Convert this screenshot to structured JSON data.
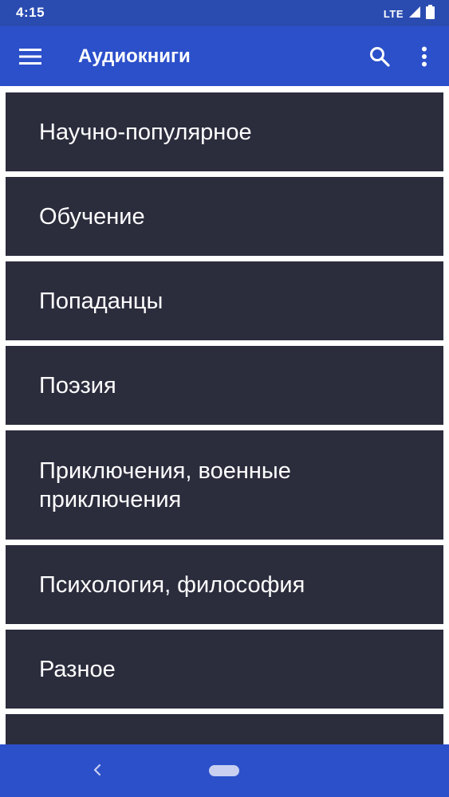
{
  "status_bar": {
    "time": "4:15",
    "network": "LTE"
  },
  "app_bar": {
    "title": "Аудиокниги",
    "icons": [
      "menu-icon",
      "search-icon",
      "more-vert-icon"
    ]
  },
  "categories": [
    "Научно-популярное",
    "Обучение",
    "Попаданцы",
    "Поэзия",
    "Приключения, военные приключения",
    "Психология, философия",
    "Разное",
    ""
  ],
  "nav_bar": {
    "icons": [
      "back-icon",
      "home-pill-icon"
    ]
  },
  "colors": {
    "status_bar": "#2a4cb1",
    "app_bar": "#2c50ca",
    "item_background": "#2b2d3d",
    "item_text": "#ffffff",
    "page_background": "#ffffff"
  }
}
